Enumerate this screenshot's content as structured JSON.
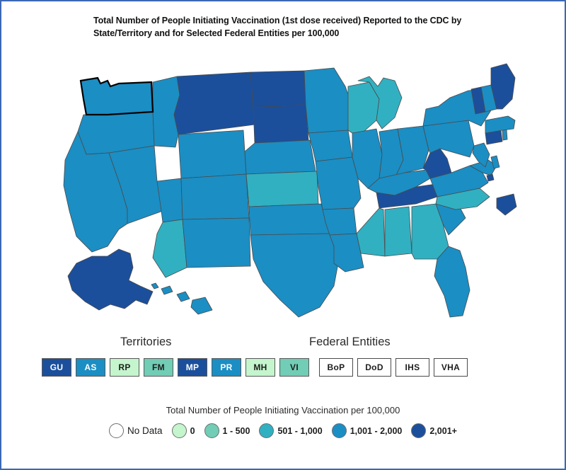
{
  "title": "Total Number of People Initiating Vaccination (1st dose received) Reported to the CDC by State/Territory and for Selected Federal Entities per 100,000",
  "frame": {
    "border_color": "#3c68b4"
  },
  "territories": {
    "heading": "Territories",
    "items": [
      {
        "code": "GU",
        "bucket": "2,001+",
        "color": "#1b4f9c",
        "text_color": "light"
      },
      {
        "code": "AS",
        "bucket": "1,001 - 2,000",
        "color": "#1b8ec4",
        "text_color": "light"
      },
      {
        "code": "RP",
        "bucket": "0",
        "color": "#c4f5cd",
        "text_color": "dark"
      },
      {
        "code": "FM",
        "bucket": "1 - 500",
        "color": "#71cdb5",
        "text_color": "dark"
      },
      {
        "code": "MP",
        "bucket": "2,001+",
        "color": "#1b4f9c",
        "text_color": "light"
      },
      {
        "code": "PR",
        "bucket": "1,001 - 2,000",
        "color": "#1b8ec4",
        "text_color": "light"
      },
      {
        "code": "MH",
        "bucket": "0",
        "color": "#c4f5cd",
        "text_color": "dark"
      },
      {
        "code": "VI",
        "bucket": "1 - 500",
        "color": "#71cdb5",
        "text_color": "dark"
      }
    ]
  },
  "federal_entities": {
    "heading": "Federal Entities",
    "items": [
      {
        "code": "BoP",
        "bucket": "No Data"
      },
      {
        "code": "DoD",
        "bucket": "No Data"
      },
      {
        "code": "IHS",
        "bucket": "No Data"
      },
      {
        "code": "VHA",
        "bucket": "No Data"
      }
    ]
  },
  "legend": {
    "title": "Total Number of People Initiating Vaccination per 100,000",
    "items": [
      {
        "label": "No Data",
        "color": "#ffffff"
      },
      {
        "label": "0",
        "color": "#c4f5cd"
      },
      {
        "label": "1 - 500",
        "color": "#71cdb5"
      },
      {
        "label": "501 - 1,000",
        "color": "#31b0c1"
      },
      {
        "label": "1,001 - 2,000",
        "color": "#1b8ec4"
      },
      {
        "label": "2,001+",
        "color": "#1b4f9c"
      }
    ]
  },
  "chart_data": {
    "type": "map",
    "title": "Total Number of People Initiating Vaccination (1st dose received) Reported to the CDC by State/Territory and for Selected Federal Entities per 100,000",
    "metric": "Total Number of People Initiating Vaccination per 100,000",
    "selected": [
      "WA"
    ],
    "buckets": [
      {
        "label": "No Data",
        "color": "#ffffff"
      },
      {
        "label": "0",
        "color": "#c4f5cd"
      },
      {
        "label": "1 - 500",
        "color": "#71cdb5"
      },
      {
        "label": "501 - 1,000",
        "color": "#31b0c1"
      },
      {
        "label": "1,001 - 2,000",
        "color": "#1b8ec4"
      },
      {
        "label": "2,001+",
        "color": "#1b4f9c"
      }
    ],
    "states": {
      "AK": "2,001+",
      "AL": "501 - 1,000",
      "AR": "1,001 - 2,000",
      "AZ": "501 - 1,000",
      "CA": "1,001 - 2,000",
      "CO": "1,001 - 2,000",
      "CT": "2,001+",
      "DC": "2,001+",
      "DE": "1,001 - 2,000",
      "FL": "1,001 - 2,000",
      "GA": "501 - 1,000",
      "HI": "1,001 - 2,000",
      "IA": "1,001 - 2,000",
      "ID": "1,001 - 2,000",
      "IL": "1,001 - 2,000",
      "IN": "1,001 - 2,000",
      "KS": "501 - 1,000",
      "KY": "1,001 - 2,000",
      "LA": "1,001 - 2,000",
      "MA": "1,001 - 2,000",
      "MD": "1,001 - 2,000",
      "ME": "2,001+",
      "MI": "501 - 1,000",
      "MN": "1,001 - 2,000",
      "MO": "1,001 - 2,000",
      "MS": "501 - 1,000",
      "MT": "2,001+",
      "NC": "501 - 1,000",
      "ND": "2,001+",
      "NE": "1,001 - 2,000",
      "NH": "1,001 - 2,000",
      "NJ": "1,001 - 2,000",
      "NM": "1,001 - 2,000",
      "NV": "1,001 - 2,000",
      "NY": "1,001 - 2,000",
      "OH": "1,001 - 2,000",
      "OK": "1,001 - 2,000",
      "OR": "1,001 - 2,000",
      "PA": "1,001 - 2,000",
      "RI": "1,001 - 2,000",
      "SC": "1,001 - 2,000",
      "SD": "2,001+",
      "TN": "2,001+",
      "TX": "1,001 - 2,000",
      "UT": "1,001 - 2,000",
      "VA": "1,001 - 2,000",
      "VT": "2,001+",
      "WA": "1,001 - 2,000",
      "WI": "501 - 1,000",
      "WV": "2,001+",
      "WY": "1,001 - 2,000"
    }
  }
}
